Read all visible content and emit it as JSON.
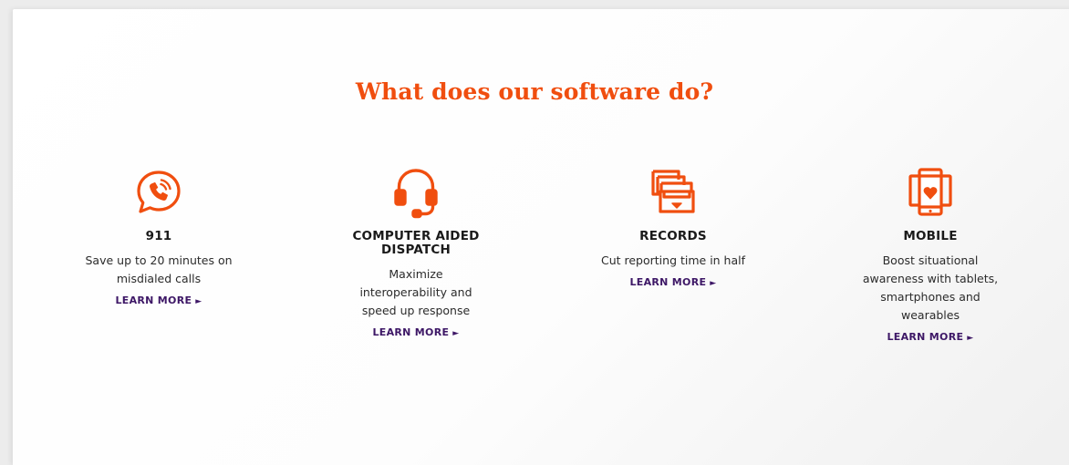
{
  "section": {
    "headline": "What does our software do?"
  },
  "colors": {
    "accent": "#f04e0f",
    "link": "#3d1766",
    "text": "#1a1a1a"
  },
  "features": [
    {
      "icon": "phone-chat-bubble-icon",
      "title": "911",
      "description": "Save up to 20 minutes on misdialed calls",
      "link_label": "LEARN MORE",
      "link_arrow": "►"
    },
    {
      "icon": "headset-icon",
      "title": "COMPUTER AIDED DISPATCH",
      "description": "Maximize interoperability and speed up response",
      "link_label": "LEARN MORE",
      "link_arrow": "►"
    },
    {
      "icon": "file-drawer-icon",
      "title": "RECORDS",
      "description": "Cut reporting time in half",
      "link_label": "LEARN MORE",
      "link_arrow": "►"
    },
    {
      "icon": "mobile-devices-icon",
      "title": "MOBILE",
      "description": "Boost situational awareness with tablets, smartphones and wearables",
      "link_label": "LEARN MORE",
      "link_arrow": "►"
    }
  ]
}
